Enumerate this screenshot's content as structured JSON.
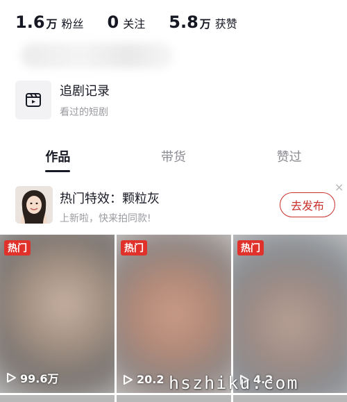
{
  "stats": {
    "followers": {
      "number": "1.6",
      "unit": "万",
      "label": "粉丝"
    },
    "following": {
      "number": "0",
      "unit": "",
      "label": "关注"
    },
    "likes": {
      "number": "5.8",
      "unit": "万",
      "label": "获赞"
    }
  },
  "drama_history": {
    "title": "追剧记录",
    "subtitle": "看过的短剧",
    "icon": "clapperboard-icon"
  },
  "tabs": [
    {
      "label": "作品",
      "active": true
    },
    {
      "label": "带货",
      "active": false
    },
    {
      "label": "赞过",
      "active": false
    }
  ],
  "promo": {
    "title": "热门特效：颗粒灰",
    "subtitle": "上新啦，快来拍同款!",
    "button": "去发布",
    "close": "×"
  },
  "videos": [
    {
      "badge": "热门",
      "plays": "99.6万"
    },
    {
      "badge": "热门",
      "plays": "20.2"
    },
    {
      "badge": "热门",
      "plays": "4.2"
    }
  ],
  "watermark": "hszhiku.com",
  "colors": {
    "accent": "#e0312b",
    "button_border": "#c9302c",
    "text_primary": "#161823",
    "text_secondary": "#9a9ba0"
  }
}
